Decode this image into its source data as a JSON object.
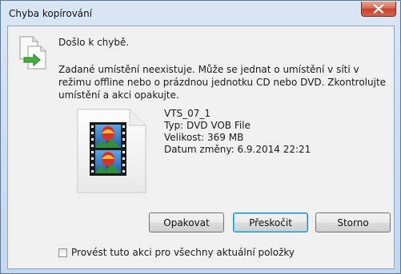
{
  "window": {
    "title": "Chyba kopírování"
  },
  "dialog": {
    "heading": "Došlo k chybě.",
    "message": "Zadané umístění neexistuje. Může se jednat o umístění v síti v režimu offline nebo o prázdnou jednotku CD nebo DVD. Zkontrolujte umístění a akci opakujte."
  },
  "file": {
    "name": "VTS_07_1",
    "type": "Typ: DVD VOB File",
    "size": "Velikost: 369 MB",
    "modified": "Datum změny: 6.9.2014 22:21"
  },
  "buttons": {
    "retry": "Opakovat",
    "skip": "Přeskočit",
    "cancel": "Storno"
  },
  "checkbox": {
    "label": "Provést tuto akci pro všechny aktuální položky",
    "checked": false
  },
  "icons": {
    "close": "close-icon",
    "copy": "copy-file-icon",
    "file": "video-file-icon"
  }
}
